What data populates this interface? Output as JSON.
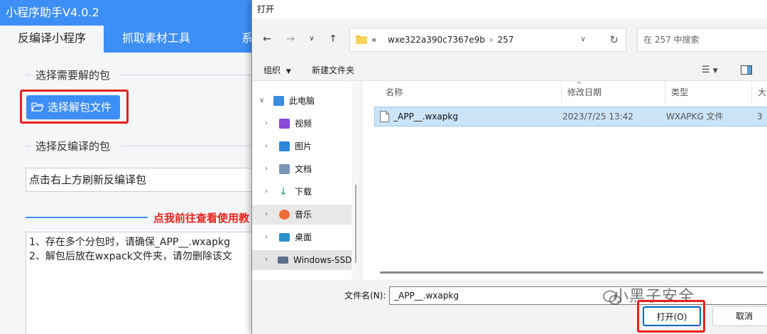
{
  "app": {
    "title": "小程序助手V4.0.2",
    "tabs": [
      {
        "label": "反编译小程序"
      },
      {
        "label": "抓取素材工具"
      },
      {
        "label": "系"
      }
    ],
    "section1_legend": "选择需要解的包",
    "select_button_label": "选择解包文件",
    "section2_legend": "选择反编译的包",
    "package_input_value": "点击右上方刷新反编译包",
    "guide_link": "点我前往查看使用教",
    "notes": [
      "1、存在多个分包时，请确保_APP__.wxapkg",
      "2、解包后放在wxpack文件夹，请勿删除该文"
    ],
    "accent_color": "#3d8ef5",
    "highlight_color": "#e8211c"
  },
  "dialog": {
    "title": "打开",
    "address": {
      "prefix": "«",
      "path": [
        "wxe322a390c7367e9b",
        "257"
      ]
    },
    "search_placeholder": "在 257 中搜索",
    "toolbar": {
      "organize": "组织",
      "new_folder": "新建文件夹"
    },
    "nav": [
      {
        "label": "此电脑",
        "icon": "computer-icon"
      },
      {
        "label": "视频",
        "icon": "video-icon"
      },
      {
        "label": "图片",
        "icon": "picture-icon"
      },
      {
        "label": "文档",
        "icon": "document-icon"
      },
      {
        "label": "下载",
        "icon": "download-icon"
      },
      {
        "label": "音乐",
        "icon": "music-icon"
      },
      {
        "label": "桌面",
        "icon": "desktop-icon"
      },
      {
        "label": "Windows-SSD",
        "icon": "drive-icon"
      }
    ],
    "columns": [
      "名称",
      "修改日期",
      "类型",
      "大小"
    ],
    "files": [
      {
        "name": "_APP__.wxapkg",
        "modified": "2023/7/25 13:42",
        "type": "WXAPKG 文件",
        "size": "3"
      }
    ],
    "filename_label": "文件名(N):",
    "filename_value": "_APP__.wxapkg",
    "open_button": "打开(O)",
    "cancel_button": "取消",
    "watermark": "小黑子安全"
  }
}
